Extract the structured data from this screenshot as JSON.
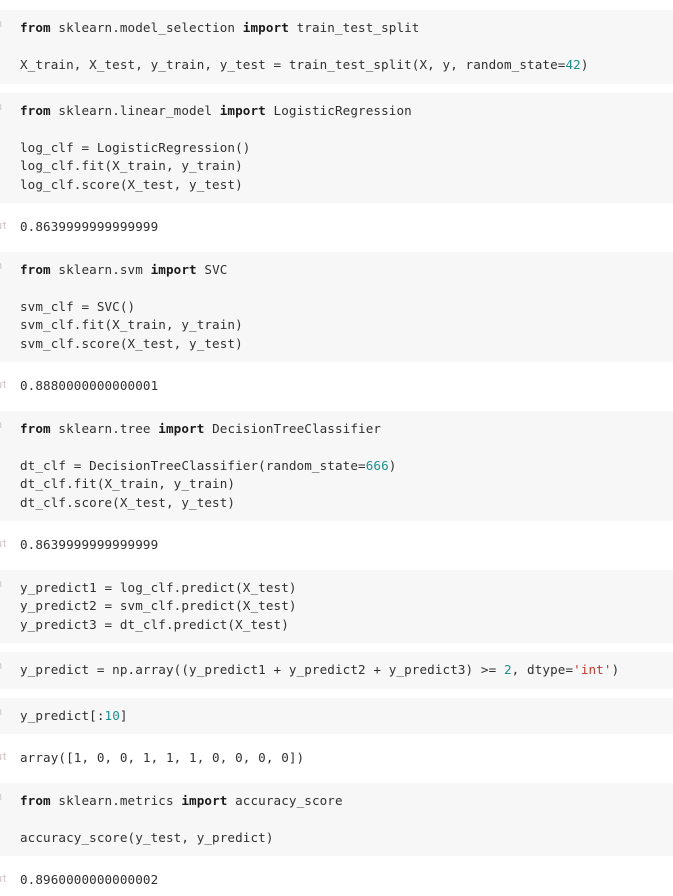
{
  "notebook": {
    "kernel_language": "python",
    "colors": {
      "cell_background": "#f7f7f7",
      "output_background": "#ffffff",
      "text": "#303030",
      "keyword": "#1a1a1a",
      "number": "#1d8f8f",
      "string": "#c0392b",
      "prompt": "#c8c8c8"
    },
    "cells": [
      {
        "type": "code",
        "prompt": "In",
        "lines": [
          [
            {
              "t": "from ",
              "c": "k"
            },
            {
              "t": "sklearn.model_selection ",
              "c": ""
            },
            {
              "t": "import ",
              "c": "k"
            },
            {
              "t": "train_test_split",
              "c": ""
            }
          ],
          [
            {
              "t": "",
              "c": ""
            }
          ],
          [
            {
              "t": "X_train, X_test, y_train, y_test = train_test_split(X, y, random_state=",
              "c": ""
            },
            {
              "t": "42",
              "c": "n"
            },
            {
              "t": ")",
              "c": ""
            }
          ]
        ]
      },
      {
        "type": "code",
        "prompt": "In",
        "lines": [
          [
            {
              "t": "from ",
              "c": "k"
            },
            {
              "t": "sklearn.linear_model ",
              "c": ""
            },
            {
              "t": "import ",
              "c": "k"
            },
            {
              "t": "LogisticRegression",
              "c": ""
            }
          ],
          [
            {
              "t": "",
              "c": ""
            }
          ],
          [
            {
              "t": "log_clf = LogisticRegression()",
              "c": ""
            }
          ],
          [
            {
              "t": "log_clf.fit(X_train, y_train)",
              "c": ""
            }
          ],
          [
            {
              "t": "log_clf.score(X_test, y_test)",
              "c": ""
            }
          ]
        ]
      },
      {
        "type": "output",
        "prompt": "Out",
        "lines": [
          [
            {
              "t": "0.8639999999999999",
              "c": ""
            }
          ]
        ]
      },
      {
        "type": "code",
        "prompt": "In",
        "lines": [
          [
            {
              "t": "from ",
              "c": "k"
            },
            {
              "t": "sklearn.svm ",
              "c": ""
            },
            {
              "t": "import ",
              "c": "k"
            },
            {
              "t": "SVC",
              "c": ""
            }
          ],
          [
            {
              "t": "",
              "c": ""
            }
          ],
          [
            {
              "t": "svm_clf = SVC()",
              "c": ""
            }
          ],
          [
            {
              "t": "svm_clf.fit(X_train, y_train)",
              "c": ""
            }
          ],
          [
            {
              "t": "svm_clf.score(X_test, y_test)",
              "c": ""
            }
          ]
        ]
      },
      {
        "type": "output",
        "prompt": "Out",
        "lines": [
          [
            {
              "t": "0.8880000000000001",
              "c": ""
            }
          ]
        ]
      },
      {
        "type": "code",
        "prompt": "In",
        "lines": [
          [
            {
              "t": "from ",
              "c": "k"
            },
            {
              "t": "sklearn.tree ",
              "c": ""
            },
            {
              "t": "import ",
              "c": "k"
            },
            {
              "t": "DecisionTreeClassifier",
              "c": ""
            }
          ],
          [
            {
              "t": "",
              "c": ""
            }
          ],
          [
            {
              "t": "dt_clf = DecisionTreeClassifier(random_state=",
              "c": ""
            },
            {
              "t": "666",
              "c": "n"
            },
            {
              "t": ")",
              "c": ""
            }
          ],
          [
            {
              "t": "dt_clf.fit(X_train, y_train)",
              "c": ""
            }
          ],
          [
            {
              "t": "dt_clf.score(X_test, y_test)",
              "c": ""
            }
          ]
        ]
      },
      {
        "type": "output",
        "prompt": "Out",
        "lines": [
          [
            {
              "t": "0.8639999999999999",
              "c": ""
            }
          ]
        ]
      },
      {
        "type": "code",
        "prompt": "In",
        "lines": [
          [
            {
              "t": "y_predict1 = log_clf.predict(X_test)",
              "c": ""
            }
          ],
          [
            {
              "t": "y_predict2 = svm_clf.predict(X_test)",
              "c": ""
            }
          ],
          [
            {
              "t": "y_predict3 = dt_clf.predict(X_test)",
              "c": ""
            }
          ]
        ]
      },
      {
        "type": "code",
        "prompt": "In",
        "lines": [
          [
            {
              "t": "y_predict = np.array((y_predict1 + y_predict2 + y_predict3) >= ",
              "c": ""
            },
            {
              "t": "2",
              "c": "n"
            },
            {
              "t": ", dtype=",
              "c": ""
            },
            {
              "t": "'int'",
              "c": "s"
            },
            {
              "t": ")",
              "c": ""
            }
          ]
        ]
      },
      {
        "type": "code",
        "prompt": "In",
        "lines": [
          [
            {
              "t": "y_predict[:",
              "c": ""
            },
            {
              "t": "10",
              "c": "n"
            },
            {
              "t": "]",
              "c": ""
            }
          ]
        ]
      },
      {
        "type": "output",
        "prompt": "Out",
        "lines": [
          [
            {
              "t": "array([1, 0, 0, 1, 1, 1, 0, 0, 0, 0])",
              "c": ""
            }
          ]
        ]
      },
      {
        "type": "code",
        "prompt": "In",
        "lines": [
          [
            {
              "t": "from ",
              "c": "k"
            },
            {
              "t": "sklearn.metrics ",
              "c": ""
            },
            {
              "t": "import ",
              "c": "k"
            },
            {
              "t": "accuracy_score",
              "c": ""
            }
          ],
          [
            {
              "t": "",
              "c": ""
            }
          ],
          [
            {
              "t": "accuracy_score(y_test, y_predict)",
              "c": ""
            }
          ]
        ]
      },
      {
        "type": "output",
        "prompt": "Out",
        "lines": [
          [
            {
              "t": "0.8960000000000002",
              "c": ""
            }
          ]
        ]
      }
    ]
  }
}
